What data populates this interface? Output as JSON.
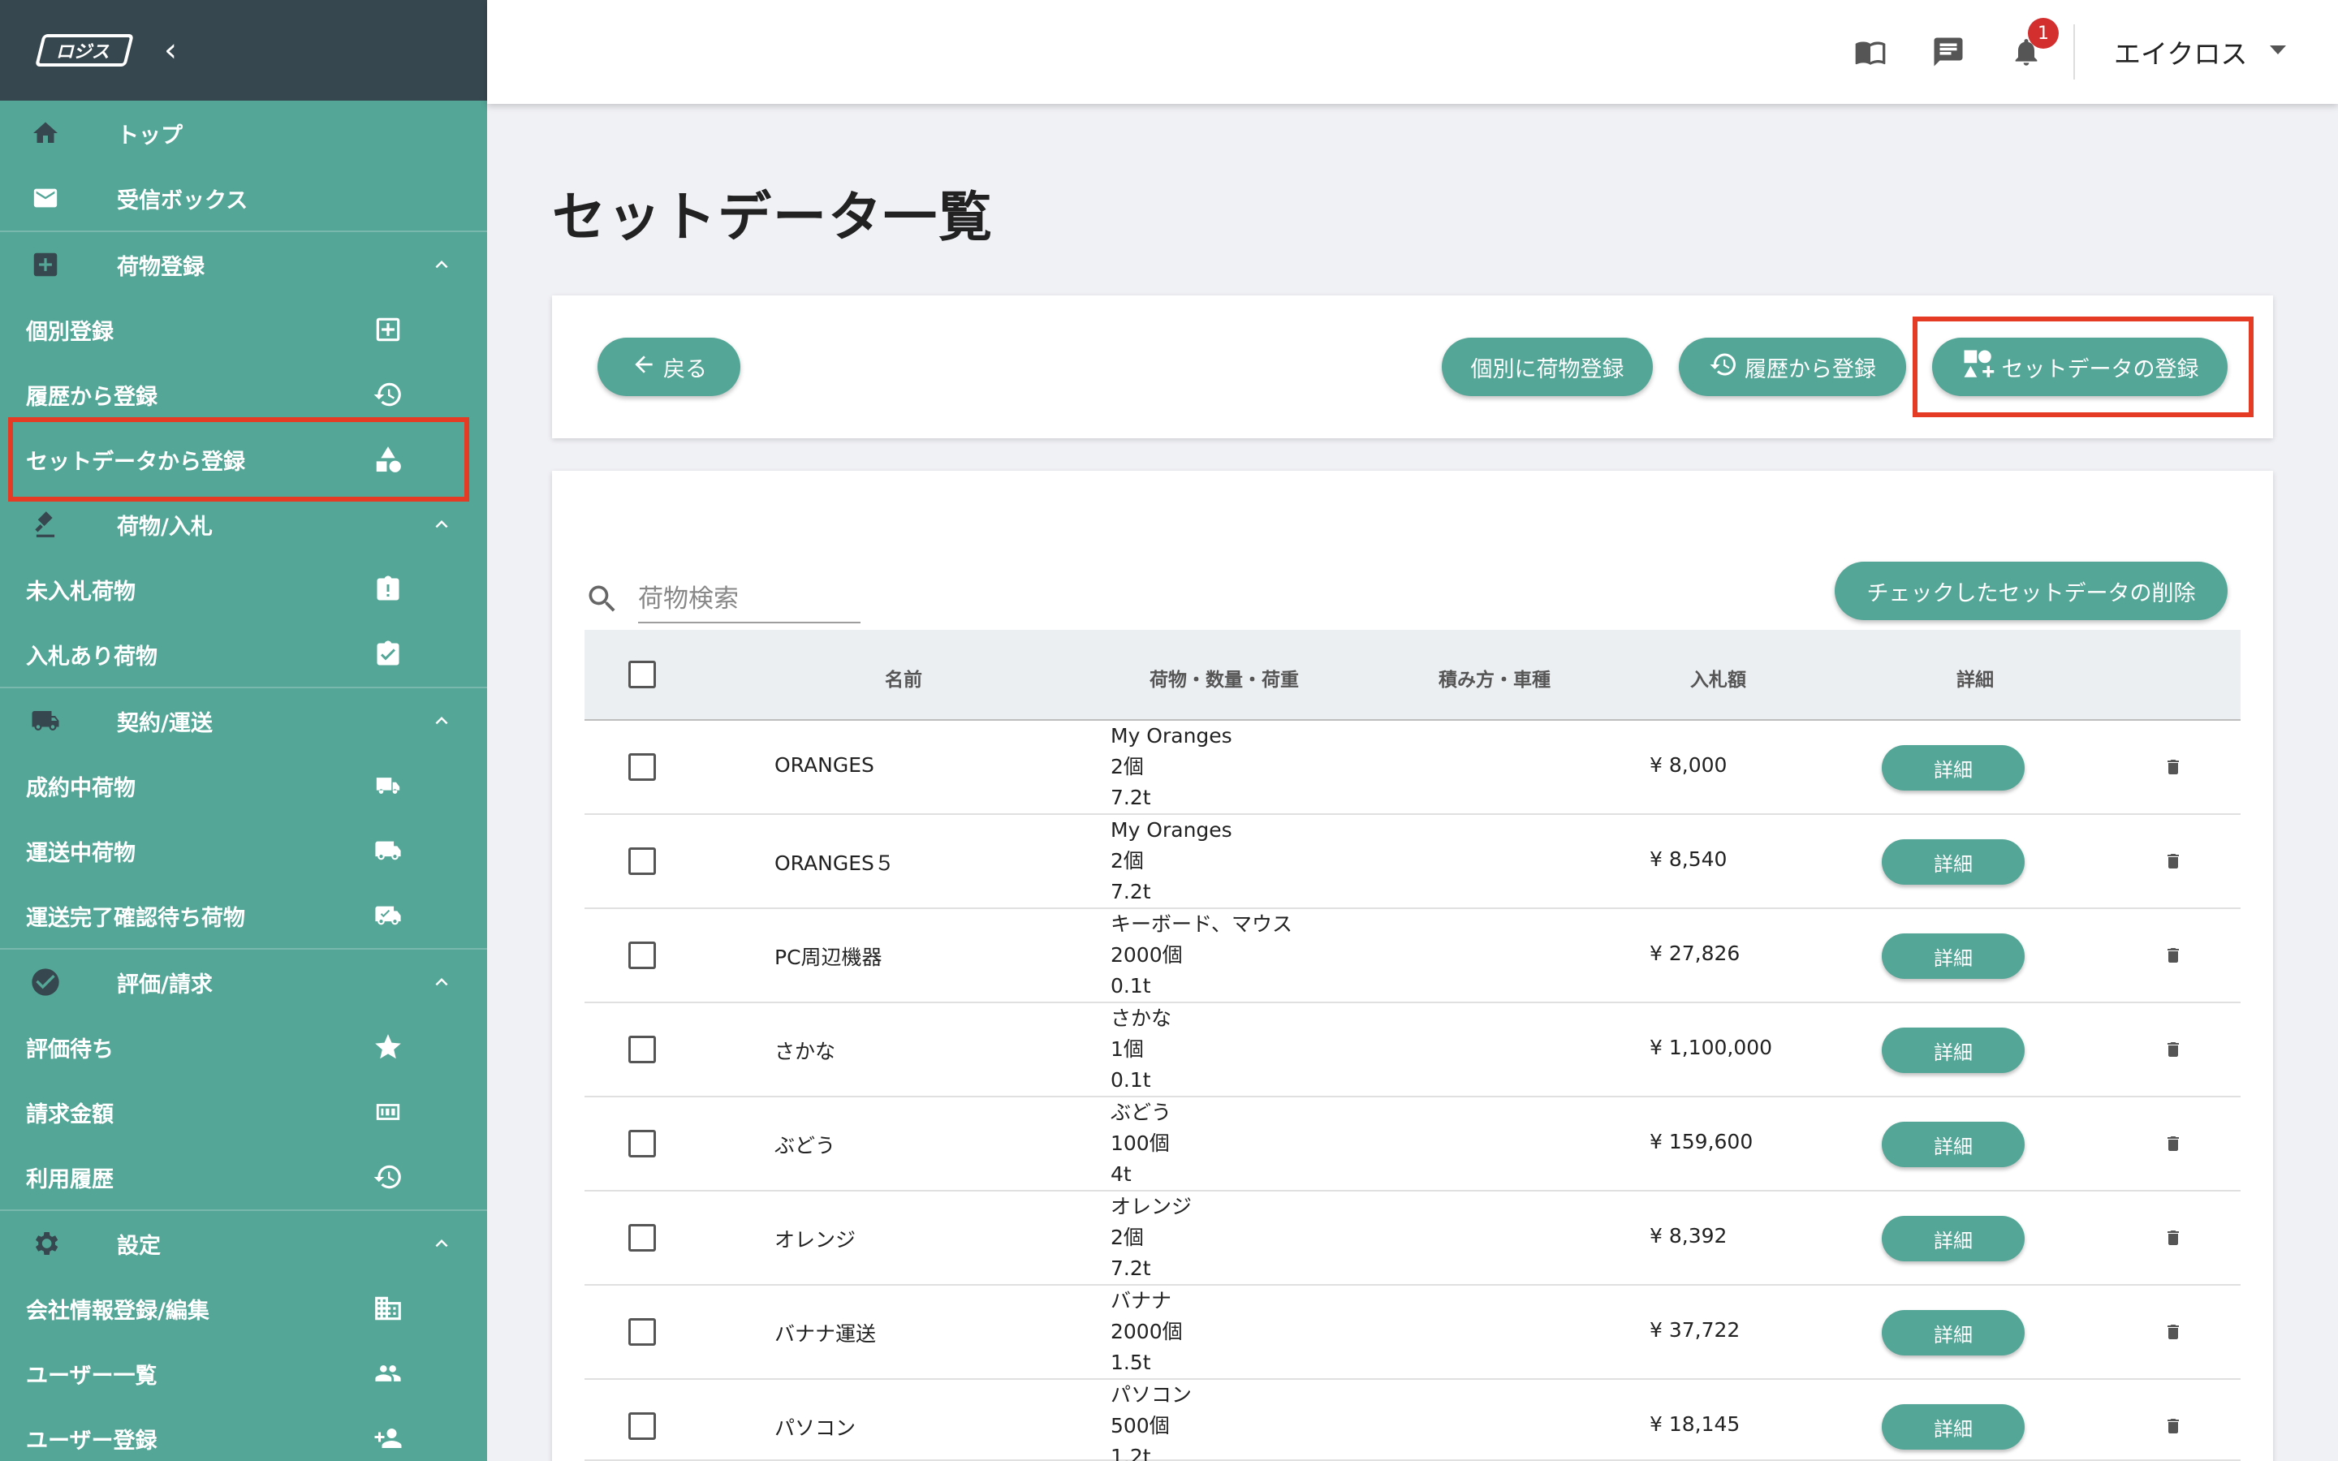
{
  "sidebar": {
    "logo_text": "ロジス",
    "collapse_glyph": "‹",
    "items": [
      {
        "label": "トップ",
        "icon": "home-icon"
      },
      {
        "label": "受信ボックス",
        "icon": "mail-icon"
      },
      {
        "label": "荷物登録",
        "icon": "add-box-icon"
      },
      {
        "label": "個別登録",
        "icon": "add-square-icon"
      },
      {
        "label": "履歴から登録",
        "icon": "history-icon"
      },
      {
        "label": "セットデータから登録",
        "icon": "category-icon"
      },
      {
        "label": "荷物/入札",
        "icon": "gavel-icon"
      },
      {
        "label": "未入札荷物",
        "icon": "clipboard-alert-icon"
      },
      {
        "label": "入札あり荷物",
        "icon": "clipboard-check-icon"
      },
      {
        "label": "契約/運送",
        "icon": "truck-icon"
      },
      {
        "label": "成約中荷物",
        "icon": "truck-small-icon"
      },
      {
        "label": "運送中荷物",
        "icon": "truck-moving-icon"
      },
      {
        "label": "運送完了確認待ち荷物",
        "icon": "truck-check-icon"
      },
      {
        "label": "評価/請求",
        "icon": "check-circle-icon"
      },
      {
        "label": "評価待ち",
        "icon": "star-icon"
      },
      {
        "label": "請求金額",
        "icon": "counter-icon"
      },
      {
        "label": "利用履歴",
        "icon": "history-icon"
      },
      {
        "label": "設定",
        "icon": "gear-icon"
      },
      {
        "label": "会社情報登録/編集",
        "icon": "building-icon"
      },
      {
        "label": "ユーザー一覧",
        "icon": "users-icon"
      },
      {
        "label": "ユーザー登録",
        "icon": "add-user-icon"
      }
    ]
  },
  "topbar": {
    "user_name": "エイクロス",
    "notification_count": "1"
  },
  "page": {
    "title": "セットデータ一覧"
  },
  "actions": {
    "back": "戻る",
    "individual": "個別に荷物登録",
    "history": "履歴から登録",
    "set_register": "セットデータの登録",
    "delete_checked": "チェックしたセットデータの削除"
  },
  "search": {
    "placeholder": "荷物検索"
  },
  "table": {
    "headers": {
      "name": "名前",
      "cargo": "荷物・数量・荷重",
      "loading": "積み方・車種",
      "price": "入札額",
      "detail": "詳細"
    },
    "detail_label": "詳細",
    "rows": [
      {
        "name": "ORANGES",
        "cargo": "My Oranges",
        "qty": "2個",
        "weight": "7.2t",
        "price": "¥ 8,000"
      },
      {
        "name": "ORANGES５",
        "cargo": "My Oranges",
        "qty": "2個",
        "weight": "7.2t",
        "price": "¥ 8,540"
      },
      {
        "name": "PC周辺機器",
        "cargo": "キーボード、マウス",
        "qty": "2000個",
        "weight": "0.1t",
        "price": "¥ 27,826"
      },
      {
        "name": "さかな",
        "cargo": "さかな",
        "qty": "1個",
        "weight": "0.1t",
        "price": "¥ 1,100,000"
      },
      {
        "name": "ぶどう",
        "cargo": "ぶどう",
        "qty": "100個",
        "weight": "4t",
        "price": "¥ 159,600"
      },
      {
        "name": "オレンジ",
        "cargo": "オレンジ",
        "qty": "2個",
        "weight": "7.2t",
        "price": "¥ 8,392"
      },
      {
        "name": "バナナ運送",
        "cargo": "バナナ",
        "qty": "2000個",
        "weight": "1.5t",
        "price": "¥ 37,722"
      },
      {
        "name": "パソコン",
        "cargo": "パソコン",
        "qty": "500個",
        "weight": "1.2t",
        "price": "¥ 18,145"
      }
    ]
  },
  "colors": {
    "sidebar_bg": "#54a697",
    "sidebar_head": "#37474f",
    "accent": "#54a697",
    "highlight": "#e53a24",
    "badge": "#d32f2f"
  }
}
